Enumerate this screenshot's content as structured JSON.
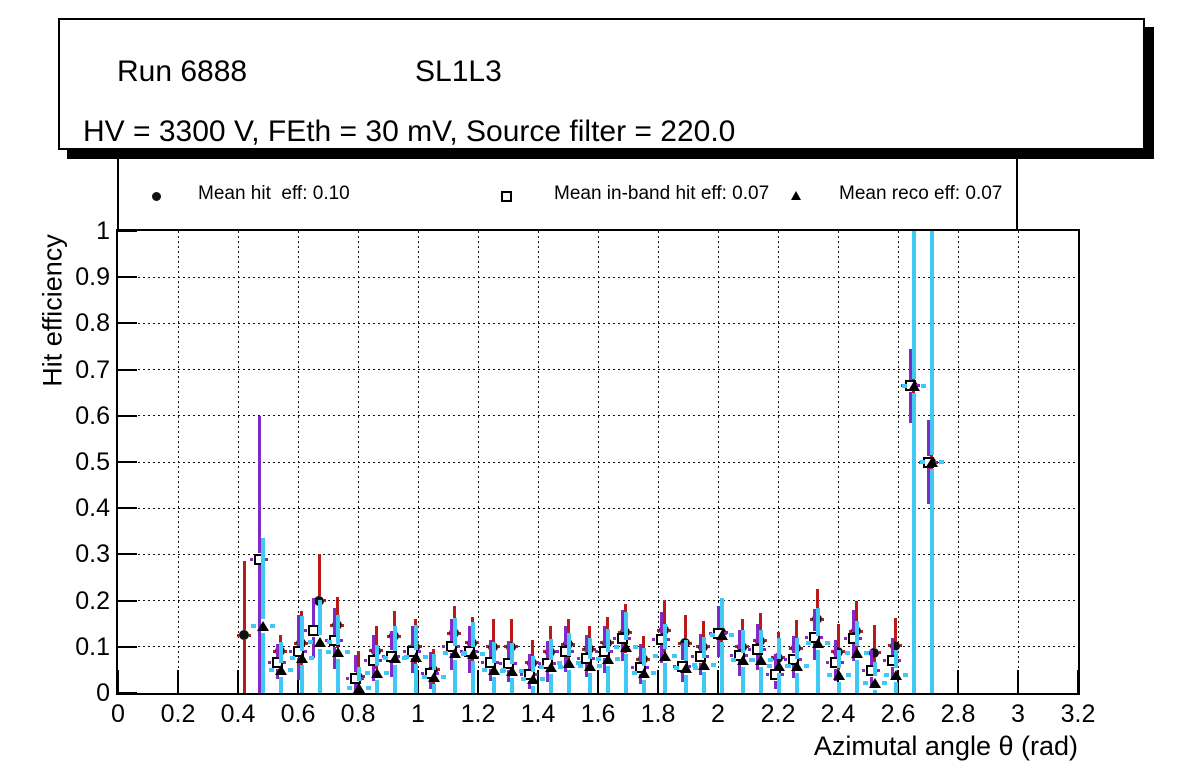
{
  "title_box": {
    "run": "Run 6888",
    "chamber": "SL1L3",
    "conditions": "HV = 3300 V, FEth = 30 mV, Source filter = 220.0"
  },
  "legend": {
    "entries": [
      {
        "marker": "filled-circle",
        "label": "Mean hit  eff: 0.10",
        "mean": 0.1
      },
      {
        "marker": "open-square",
        "label": "Mean in-band hit eff: 0.07",
        "mean": 0.07
      },
      {
        "marker": "filled-triangle",
        "label": "Mean reco eff: 0.07",
        "mean": 0.07
      }
    ]
  },
  "colors": {
    "hit_error": "#bb1a1a",
    "inband_error": "#8429c9",
    "reco_error": "#3fc9f4",
    "marker": "#111111",
    "frame": "#000000"
  },
  "chart_data": {
    "type": "scatter",
    "title": "Run 6888 SL1L3 — hit efficiency vs azimutal angle",
    "xlabel": "Azimutal angle θ (rad)",
    "ylabel": "Hit efficiency",
    "xlim": [
      0,
      3.2
    ],
    "ylim": [
      0,
      1
    ],
    "grid": "dotted",
    "legend_position": "top",
    "x_ticks": [
      {
        "v": 0,
        "label": "0"
      },
      {
        "v": 0.2,
        "label": "0.2"
      },
      {
        "v": 0.4,
        "label": "0.4"
      },
      {
        "v": 0.6,
        "label": "0.6"
      },
      {
        "v": 0.8,
        "label": "0.8"
      },
      {
        "v": 1,
        "label": "1"
      },
      {
        "v": 1.2,
        "label": "1.2"
      },
      {
        "v": 1.4,
        "label": "1.4"
      },
      {
        "v": 1.6,
        "label": "1.6"
      },
      {
        "v": 1.8,
        "label": "1.8"
      },
      {
        "v": 2,
        "label": "2"
      },
      {
        "v": 2.2,
        "label": "2.2"
      },
      {
        "v": 2.4,
        "label": "2.4"
      },
      {
        "v": 2.6,
        "label": "2.6"
      },
      {
        "v": 2.8,
        "label": "2.8"
      },
      {
        "v": 3,
        "label": "3"
      },
      {
        "v": 3.2,
        "label": "3.2"
      }
    ],
    "y_ticks": [
      {
        "v": 0,
        "label": "0"
      },
      {
        "v": 0.1,
        "label": "0.1"
      },
      {
        "v": 0.2,
        "label": "0.2"
      },
      {
        "v": 0.3,
        "label": "0.3"
      },
      {
        "v": 0.4,
        "label": "0.4"
      },
      {
        "v": 0.5,
        "label": "0.5"
      },
      {
        "v": 0.6,
        "label": "0.6"
      },
      {
        "v": 0.7,
        "label": "0.7"
      },
      {
        "v": 0.8,
        "label": "0.8"
      },
      {
        "v": 0.9,
        "label": "0.9"
      },
      {
        "v": 1,
        "label": "1"
      }
    ],
    "series": [
      {
        "name": "Mean hit eff",
        "marker": "filled-circle",
        "error_color": "#bb1a1a",
        "ex": 0.024,
        "points": [
          [
            0.42,
            0.125,
            0.125,
            0.16
          ],
          [
            0.54,
            0.09,
            0.04,
            0.035
          ],
          [
            0.61,
            0.108,
            0.05,
            0.07
          ],
          [
            0.67,
            0.2,
            0.05,
            0.1
          ],
          [
            0.73,
            0.147,
            0.05,
            0.06
          ],
          [
            0.8,
            0.035,
            0.035,
            0.055
          ],
          [
            0.86,
            0.091,
            0.04,
            0.055
          ],
          [
            0.92,
            0.123,
            0.045,
            0.055
          ],
          [
            0.99,
            0.1,
            0.04,
            0.06
          ],
          [
            1.05,
            0.05,
            0.035,
            0.045
          ],
          [
            1.12,
            0.129,
            0.045,
            0.06
          ],
          [
            1.18,
            0.109,
            0.04,
            0.055
          ],
          [
            1.25,
            0.1,
            0.045,
            0.06
          ],
          [
            1.31,
            0.1,
            0.045,
            0.06
          ],
          [
            1.38,
            0.065,
            0.035,
            0.05
          ],
          [
            1.44,
            0.089,
            0.04,
            0.055
          ],
          [
            1.5,
            0.105,
            0.04,
            0.055
          ],
          [
            1.57,
            0.095,
            0.04,
            0.05
          ],
          [
            1.63,
            0.109,
            0.04,
            0.055
          ],
          [
            1.69,
            0.132,
            0.045,
            0.06
          ],
          [
            1.75,
            0.073,
            0.035,
            0.05
          ],
          [
            1.82,
            0.136,
            0.05,
            0.065
          ],
          [
            1.89,
            0.108,
            0.04,
            0.06
          ],
          [
            1.95,
            0.1,
            0.04,
            0.055
          ],
          [
            2.01,
            0.132,
            0.045,
            0.065
          ],
          [
            2.08,
            0.1,
            0.04,
            0.06
          ],
          [
            2.14,
            0.113,
            0.045,
            0.06
          ],
          [
            2.2,
            0.076,
            0.04,
            0.055
          ],
          [
            2.26,
            0.097,
            0.04,
            0.06
          ],
          [
            2.33,
            0.16,
            0.05,
            0.065
          ],
          [
            2.4,
            0.089,
            0.04,
            0.06
          ],
          [
            2.46,
            0.134,
            0.05,
            0.065
          ],
          [
            2.52,
            0.087,
            0.04,
            0.06
          ],
          [
            2.59,
            0.102,
            0.045,
            0.06
          ],
          [
            2.65,
            0.665,
            0.015,
            0.015
          ],
          [
            2.71,
            0.5,
            0.015,
            0.015
          ]
        ]
      },
      {
        "name": "Mean in-band hit eff",
        "marker": "open-square",
        "error_color": "#8429c9",
        "ex": 0.03,
        "points": [
          [
            0.48,
            0.29,
            0.29,
            0.31
          ],
          [
            0.54,
            0.065,
            0.035,
            0.04
          ],
          [
            0.61,
            0.089,
            0.06,
            0.08
          ],
          [
            0.66,
            0.135,
            0.06,
            0.07
          ],
          [
            0.73,
            0.113,
            0.06,
            0.07
          ],
          [
            0.8,
            0.032,
            0.032,
            0.05
          ],
          [
            0.86,
            0.071,
            0.045,
            0.055
          ],
          [
            0.92,
            0.08,
            0.045,
            0.055
          ],
          [
            0.99,
            0.089,
            0.045,
            0.055
          ],
          [
            1.05,
            0.043,
            0.035,
            0.045
          ],
          [
            1.12,
            0.1,
            0.05,
            0.06
          ],
          [
            1.18,
            0.089,
            0.045,
            0.055
          ],
          [
            1.25,
            0.065,
            0.04,
            0.05
          ],
          [
            1.31,
            0.063,
            0.04,
            0.05
          ],
          [
            1.38,
            0.039,
            0.03,
            0.045
          ],
          [
            1.44,
            0.063,
            0.04,
            0.05
          ],
          [
            1.5,
            0.09,
            0.045,
            0.055
          ],
          [
            1.57,
            0.075,
            0.04,
            0.05
          ],
          [
            1.63,
            0.089,
            0.045,
            0.055
          ],
          [
            1.69,
            0.119,
            0.05,
            0.06
          ],
          [
            1.75,
            0.055,
            0.035,
            0.05
          ],
          [
            1.82,
            0.116,
            0.05,
            0.06
          ],
          [
            1.89,
            0.058,
            0.035,
            0.05
          ],
          [
            1.95,
            0.078,
            0.04,
            0.05
          ],
          [
            2.01,
            0.128,
            0.05,
            0.06
          ],
          [
            2.08,
            0.082,
            0.045,
            0.055
          ],
          [
            2.14,
            0.095,
            0.045,
            0.055
          ],
          [
            2.2,
            0.039,
            0.03,
            0.045
          ],
          [
            2.26,
            0.073,
            0.04,
            0.05
          ],
          [
            2.33,
            0.121,
            0.05,
            0.06
          ],
          [
            2.4,
            0.065,
            0.04,
            0.05
          ],
          [
            2.46,
            0.119,
            0.05,
            0.06
          ],
          [
            2.52,
            0.048,
            0.035,
            0.045
          ],
          [
            2.59,
            0.07,
            0.04,
            0.05
          ],
          [
            2.65,
            0.665,
            0.08,
            0.08
          ],
          [
            2.71,
            0.5,
            0.09,
            0.09
          ]
        ]
      },
      {
        "name": "Mean reco eff",
        "marker": "filled-triangle",
        "error_color": "#3fc9f4",
        "ex": 0.04,
        "points": [
          [
            0.48,
            0.145,
            0.145,
            0.19
          ],
          [
            0.54,
            0.05,
            0.05,
            0.06
          ],
          [
            0.61,
            0.076,
            0.076,
            0.09
          ],
          [
            0.67,
            0.111,
            0.111,
            0.09
          ],
          [
            0.73,
            0.089,
            0.089,
            0.08
          ],
          [
            0.8,
            0.011,
            0.011,
            0.045
          ],
          [
            0.86,
            0.043,
            0.043,
            0.06
          ],
          [
            0.92,
            0.075,
            0.075,
            0.07
          ],
          [
            0.99,
            0.078,
            0.078,
            0.07
          ],
          [
            1.05,
            0.035,
            0.035,
            0.05
          ],
          [
            1.12,
            0.087,
            0.087,
            0.075
          ],
          [
            1.18,
            0.084,
            0.084,
            0.07
          ],
          [
            1.25,
            0.05,
            0.05,
            0.06
          ],
          [
            1.31,
            0.048,
            0.048,
            0.06
          ],
          [
            1.38,
            0.03,
            0.03,
            0.05
          ],
          [
            1.44,
            0.057,
            0.057,
            0.06
          ],
          [
            1.5,
            0.065,
            0.065,
            0.065
          ],
          [
            1.57,
            0.058,
            0.058,
            0.06
          ],
          [
            1.63,
            0.073,
            0.073,
            0.065
          ],
          [
            1.69,
            0.1,
            0.1,
            0.075
          ],
          [
            1.75,
            0.043,
            0.043,
            0.055
          ],
          [
            1.82,
            0.08,
            0.08,
            0.07
          ],
          [
            1.89,
            0.054,
            0.054,
            0.06
          ],
          [
            1.95,
            0.061,
            0.061,
            0.06
          ],
          [
            2.01,
            0.125,
            0.125,
            0.08
          ],
          [
            2.08,
            0.071,
            0.071,
            0.065
          ],
          [
            2.14,
            0.071,
            0.071,
            0.065
          ],
          [
            2.2,
            0.058,
            0.058,
            0.06
          ],
          [
            2.26,
            0.058,
            0.058,
            0.06
          ],
          [
            2.33,
            0.108,
            0.108,
            0.075
          ],
          [
            2.4,
            0.039,
            0.039,
            0.055
          ],
          [
            2.46,
            0.086,
            0.086,
            0.07
          ],
          [
            2.52,
            0.022,
            0.022,
            0.045
          ],
          [
            2.59,
            0.039,
            0.039,
            0.055
          ],
          [
            2.65,
            0.665,
            0.665,
            0.335
          ],
          [
            2.71,
            0.5,
            0.5,
            0.5
          ]
        ]
      }
    ]
  }
}
